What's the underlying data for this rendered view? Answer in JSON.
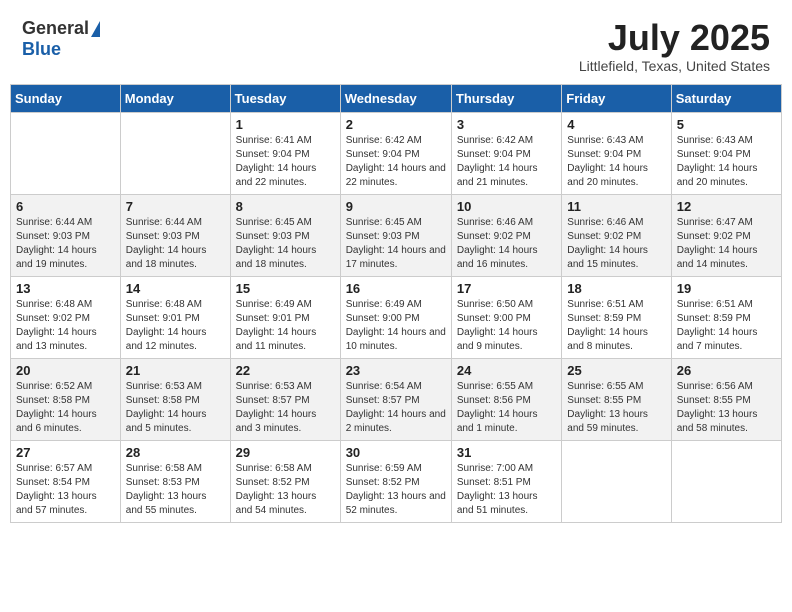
{
  "header": {
    "logo_general": "General",
    "logo_blue": "Blue",
    "month_title": "July 2025",
    "location": "Littlefield, Texas, United States"
  },
  "days_of_week": [
    "Sunday",
    "Monday",
    "Tuesday",
    "Wednesday",
    "Thursday",
    "Friday",
    "Saturday"
  ],
  "weeks": [
    [
      {
        "day": "",
        "info": ""
      },
      {
        "day": "",
        "info": ""
      },
      {
        "day": "1",
        "info": "Sunrise: 6:41 AM\nSunset: 9:04 PM\nDaylight: 14 hours and 22 minutes."
      },
      {
        "day": "2",
        "info": "Sunrise: 6:42 AM\nSunset: 9:04 PM\nDaylight: 14 hours and 22 minutes."
      },
      {
        "day": "3",
        "info": "Sunrise: 6:42 AM\nSunset: 9:04 PM\nDaylight: 14 hours and 21 minutes."
      },
      {
        "day": "4",
        "info": "Sunrise: 6:43 AM\nSunset: 9:04 PM\nDaylight: 14 hours and 20 minutes."
      },
      {
        "day": "5",
        "info": "Sunrise: 6:43 AM\nSunset: 9:04 PM\nDaylight: 14 hours and 20 minutes."
      }
    ],
    [
      {
        "day": "6",
        "info": "Sunrise: 6:44 AM\nSunset: 9:03 PM\nDaylight: 14 hours and 19 minutes."
      },
      {
        "day": "7",
        "info": "Sunrise: 6:44 AM\nSunset: 9:03 PM\nDaylight: 14 hours and 18 minutes."
      },
      {
        "day": "8",
        "info": "Sunrise: 6:45 AM\nSunset: 9:03 PM\nDaylight: 14 hours and 18 minutes."
      },
      {
        "day": "9",
        "info": "Sunrise: 6:45 AM\nSunset: 9:03 PM\nDaylight: 14 hours and 17 minutes."
      },
      {
        "day": "10",
        "info": "Sunrise: 6:46 AM\nSunset: 9:02 PM\nDaylight: 14 hours and 16 minutes."
      },
      {
        "day": "11",
        "info": "Sunrise: 6:46 AM\nSunset: 9:02 PM\nDaylight: 14 hours and 15 minutes."
      },
      {
        "day": "12",
        "info": "Sunrise: 6:47 AM\nSunset: 9:02 PM\nDaylight: 14 hours and 14 minutes."
      }
    ],
    [
      {
        "day": "13",
        "info": "Sunrise: 6:48 AM\nSunset: 9:02 PM\nDaylight: 14 hours and 13 minutes."
      },
      {
        "day": "14",
        "info": "Sunrise: 6:48 AM\nSunset: 9:01 PM\nDaylight: 14 hours and 12 minutes."
      },
      {
        "day": "15",
        "info": "Sunrise: 6:49 AM\nSunset: 9:01 PM\nDaylight: 14 hours and 11 minutes."
      },
      {
        "day": "16",
        "info": "Sunrise: 6:49 AM\nSunset: 9:00 PM\nDaylight: 14 hours and 10 minutes."
      },
      {
        "day": "17",
        "info": "Sunrise: 6:50 AM\nSunset: 9:00 PM\nDaylight: 14 hours and 9 minutes."
      },
      {
        "day": "18",
        "info": "Sunrise: 6:51 AM\nSunset: 8:59 PM\nDaylight: 14 hours and 8 minutes."
      },
      {
        "day": "19",
        "info": "Sunrise: 6:51 AM\nSunset: 8:59 PM\nDaylight: 14 hours and 7 minutes."
      }
    ],
    [
      {
        "day": "20",
        "info": "Sunrise: 6:52 AM\nSunset: 8:58 PM\nDaylight: 14 hours and 6 minutes."
      },
      {
        "day": "21",
        "info": "Sunrise: 6:53 AM\nSunset: 8:58 PM\nDaylight: 14 hours and 5 minutes."
      },
      {
        "day": "22",
        "info": "Sunrise: 6:53 AM\nSunset: 8:57 PM\nDaylight: 14 hours and 3 minutes."
      },
      {
        "day": "23",
        "info": "Sunrise: 6:54 AM\nSunset: 8:57 PM\nDaylight: 14 hours and 2 minutes."
      },
      {
        "day": "24",
        "info": "Sunrise: 6:55 AM\nSunset: 8:56 PM\nDaylight: 14 hours and 1 minute."
      },
      {
        "day": "25",
        "info": "Sunrise: 6:55 AM\nSunset: 8:55 PM\nDaylight: 13 hours and 59 minutes."
      },
      {
        "day": "26",
        "info": "Sunrise: 6:56 AM\nSunset: 8:55 PM\nDaylight: 13 hours and 58 minutes."
      }
    ],
    [
      {
        "day": "27",
        "info": "Sunrise: 6:57 AM\nSunset: 8:54 PM\nDaylight: 13 hours and 57 minutes."
      },
      {
        "day": "28",
        "info": "Sunrise: 6:58 AM\nSunset: 8:53 PM\nDaylight: 13 hours and 55 minutes."
      },
      {
        "day": "29",
        "info": "Sunrise: 6:58 AM\nSunset: 8:52 PM\nDaylight: 13 hours and 54 minutes."
      },
      {
        "day": "30",
        "info": "Sunrise: 6:59 AM\nSunset: 8:52 PM\nDaylight: 13 hours and 52 minutes."
      },
      {
        "day": "31",
        "info": "Sunrise: 7:00 AM\nSunset: 8:51 PM\nDaylight: 13 hours and 51 minutes."
      },
      {
        "day": "",
        "info": ""
      },
      {
        "day": "",
        "info": ""
      }
    ]
  ]
}
